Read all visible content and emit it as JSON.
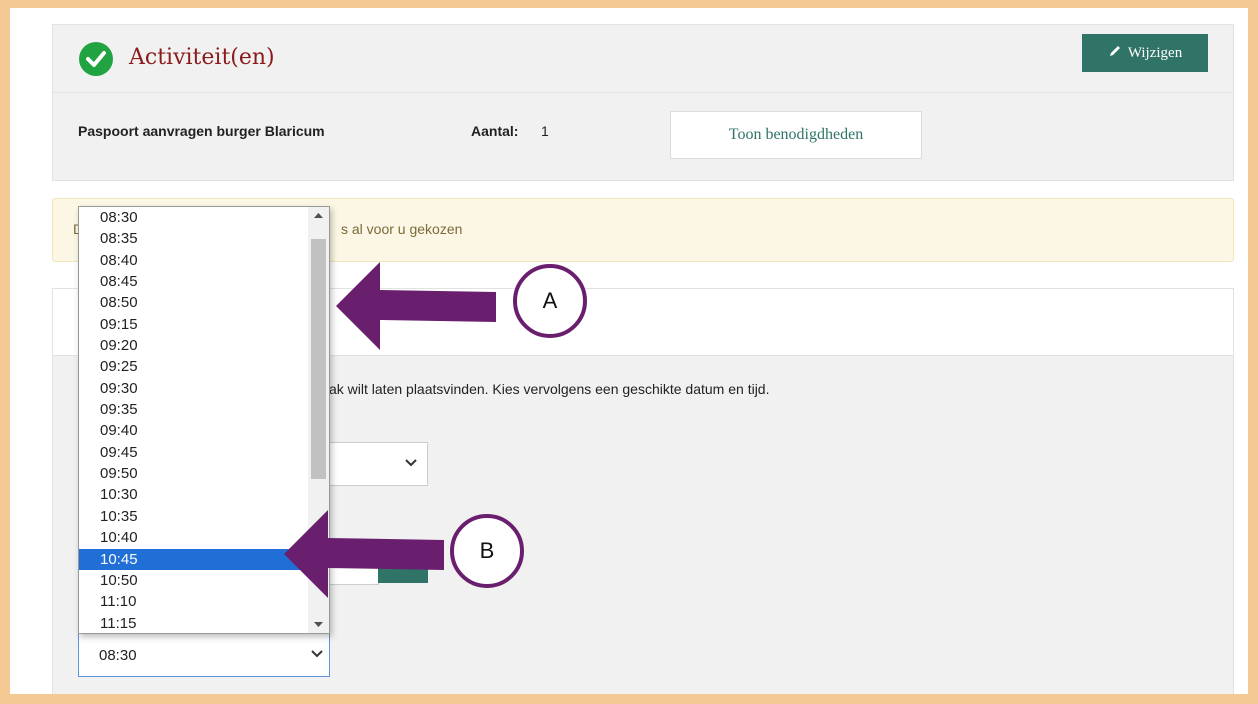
{
  "activities": {
    "title": "Activiteit(en)",
    "edit_label": "Wijzigen",
    "activity_name": "Paspoort aanvragen burger Blaricum",
    "aantal_label": "Aantal:",
    "aantal_value": "1",
    "toon_label": "Toon benodigdheden"
  },
  "notice": {
    "visible_prefix": "D",
    "visible_text": "s al voor u gekozen"
  },
  "form": {
    "instruction_visible": "ak wilt laten plaatsvinden. Kies vervolgens een geschikte datum en tijd."
  },
  "time_select": {
    "value": "08:30",
    "options": [
      "08:30",
      "08:35",
      "08:40",
      "08:45",
      "08:50",
      "09:15",
      "09:20",
      "09:25",
      "09:30",
      "09:35",
      "09:40",
      "09:45",
      "09:50",
      "10:30",
      "10:35",
      "10:40",
      "10:45",
      "10:50",
      "11:10",
      "11:15"
    ],
    "highlighted": "10:45"
  },
  "annotations": {
    "a_label": "A",
    "b_label": "B",
    "arrow_color": "#6a1f6e"
  },
  "colors": {
    "frame": "#f5c993",
    "accent_green": "#2f7467",
    "title_red": "#8b1a1a",
    "highlight_blue": "#1f6fd6"
  }
}
